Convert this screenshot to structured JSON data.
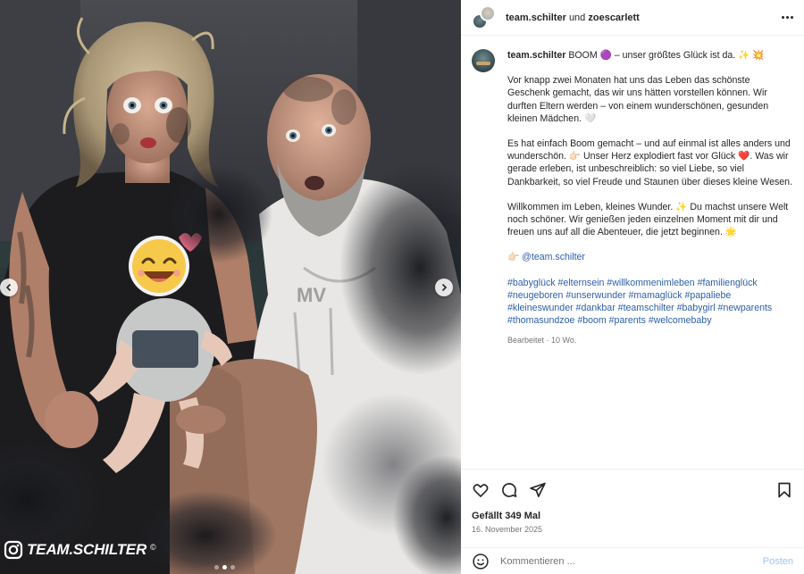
{
  "header": {
    "user1": "team.schilter",
    "joiner": "und",
    "user2": "zoescarlett",
    "more_icon": "more-horizontal-icon"
  },
  "caption": {
    "username": "team.schilter",
    "line1": "BOOM 🟣 – unser größtes Glück ist da. ✨ 💥",
    "para1": "Vor knapp zwei Monaten hat uns das Leben das schönste Geschenk gemacht, das wir uns hätten vorstellen können. Wir durften Eltern werden – von einem wunderschönen, gesunden kleinen Mädchen. 🤍",
    "para2": "Es hat einfach Boom gemacht – und auf einmal ist alles anders und wunderschön. 👉🏻 Unser Herz explodiert fast vor Glück ❤️. Was wir gerade erleben, ist unbeschreiblich: so viel Liebe, so viel Dankbarkeit, so viel Freude und Staunen über dieses kleine Wesen.",
    "para3": "Willkommen im Leben, kleines Wunder. ✨ Du machst unsere Welt noch schöner. Wir genießen jeden einzelnen Moment mit dir und freuen uns auf all die Abenteuer, die jetzt beginnen. 🌟",
    "mention_prefix": "👉🏻",
    "mention": "@team.schilter",
    "hashtags": "#babyglück #elternsein #willkommenimleben #familienglück #neugeboren #unserwunder #mamaglück #papaliebe #kleineswunder #dankbar #teamschilter #babygirl #newparents #thomasundzoe #boom #parents #welcomebaby",
    "meta": "Bearbeitet · 10 Wo."
  },
  "actions": {
    "like_icon": "heart-icon",
    "comment_icon": "comment-icon",
    "share_icon": "share-icon",
    "save_icon": "bookmark-icon",
    "likes": "Gefällt 349 Mal",
    "date": "16. November 2025"
  },
  "comment": {
    "emoji_icon": "emoji-icon",
    "placeholder": "Kommentieren ...",
    "post_label": "Posten"
  },
  "media": {
    "watermark": "TEAM.SCHILTER",
    "watermark_mark": "©",
    "carousel_total": 3,
    "carousel_active": 2
  }
}
